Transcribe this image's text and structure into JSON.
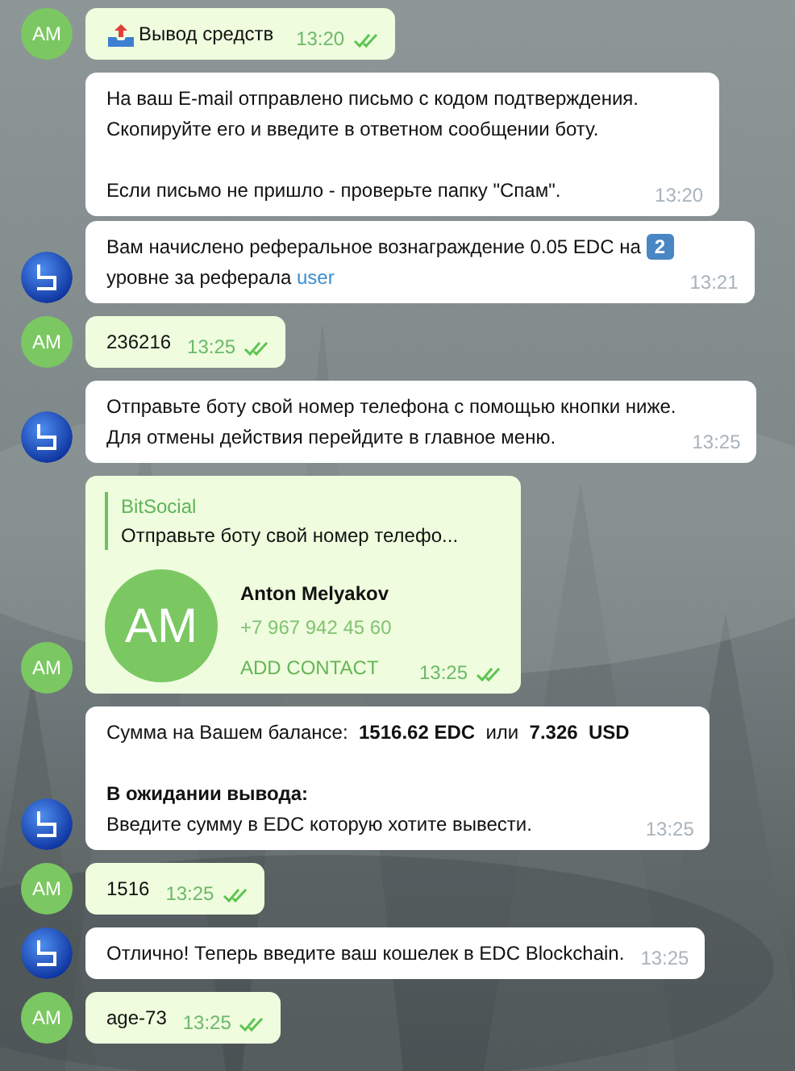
{
  "messages": [
    {
      "outgoing": true,
      "kind": "text",
      "avatar_text": "AM",
      "parts": [
        {
          "kind": "emoji"
        },
        {
          "kind": "text",
          "text": "Вывод средств"
        }
      ],
      "time": "13:20",
      "read": true
    },
    {
      "outgoing": false,
      "kind": "text",
      "parts": [
        {
          "kind": "text",
          "text": "На ваш E-mail отправлено письмо с кодом подтверждения.\nСкопируйте его и введите в ответном сообщении боту.\n\nЕсли письмо не пришло - проверьте папку \"Спам\"."
        }
      ],
      "time": "13:20"
    },
    {
      "outgoing": false,
      "kind": "text",
      "parts": [
        {
          "kind": "text",
          "text": "Вам начислено реферальное вознаграждение 0.05 EDC на "
        },
        {
          "kind": "keycap",
          "text": "2"
        },
        {
          "kind": "text",
          "text": "\nуровне за реферала "
        },
        {
          "kind": "link",
          "text": "user"
        }
      ],
      "time": "13:21"
    },
    {
      "outgoing": true,
      "kind": "text",
      "avatar_text": "AM",
      "parts": [
        {
          "kind": "text",
          "text": "236216"
        }
      ],
      "time": "13:25",
      "read": true
    },
    {
      "outgoing": false,
      "kind": "text",
      "parts": [
        {
          "kind": "text",
          "text": "Отправьте боту свой номер телефона с помощью кнопки ниже.\nДля отмены действия перейдите в главное меню."
        }
      ],
      "time": "13:25"
    },
    {
      "outgoing": true,
      "kind": "contact",
      "avatar_text": "AM",
      "reply": {
        "author": "BitSocial",
        "text": "Отправьте боту свой номер телефо..."
      },
      "contact": {
        "initials": "AM",
        "name": "Anton Melyakov",
        "phone": "+7 967 942 45 60",
        "action": "ADD CONTACT"
      },
      "time": "13:25",
      "read": true
    },
    {
      "outgoing": false,
      "kind": "text",
      "parts": [
        {
          "kind": "text",
          "text": "Сумма на Вашем балансе:  **1516.62 EDC**  или  **7.326  USD**\n\n**В ожидании вывода:**\nВведите сумму в EDC которую хотите вывести."
        }
      ],
      "time": "13:25"
    },
    {
      "outgoing": true,
      "kind": "text",
      "avatar_text": "AM",
      "parts": [
        {
          "kind": "text",
          "text": "1516"
        }
      ],
      "time": "13:25",
      "read": true
    },
    {
      "outgoing": false,
      "kind": "text",
      "parts": [
        {
          "kind": "text",
          "text": "Отлично! Теперь введите ваш кошелек в EDC Blockchain."
        }
      ],
      "time": "13:25"
    },
    {
      "outgoing": true,
      "kind": "text",
      "avatar_text": "AM",
      "parts": [
        {
          "kind": "text",
          "text": "age-73"
        }
      ],
      "time": "13:25",
      "read": true
    }
  ]
}
